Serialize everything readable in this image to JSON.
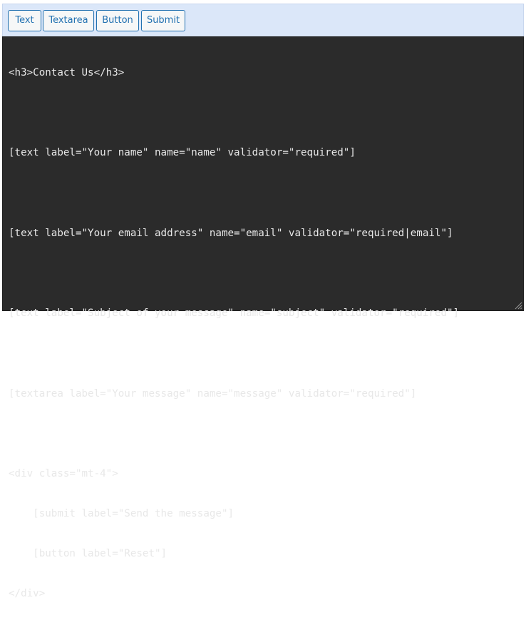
{
  "toolbar": {
    "buttons": [
      {
        "label": "Text"
      },
      {
        "label": "Textarea"
      },
      {
        "label": "Button"
      },
      {
        "label": "Submit"
      }
    ]
  },
  "editor": {
    "lines": [
      "<h3>Contact Us</h3>",
      "",
      "[text label=\"Your name\" name=\"name\" validator=\"required\"]",
      "",
      "[text label=\"Your email address\" name=\"email\" validator=\"required|email\"]",
      "",
      "[text label=\"Subject of your message\" name=\"subject\" validator=\"required\"]",
      "",
      "[textarea label=\"Your message\" name=\"message\" validator=\"required\"]",
      "",
      "<div class=\"mt-4\">",
      "    [submit label=\"Send the message\"]",
      "    [button label=\"Reset\"]",
      "</div>"
    ]
  },
  "colors": {
    "toolbar_bg": "#dbe7f9",
    "button_text": "#2271b1",
    "editor_bg": "#2b2b2b",
    "editor_text": "#e8e8e8"
  },
  "icons": {
    "resize": "resize-grip-icon"
  }
}
